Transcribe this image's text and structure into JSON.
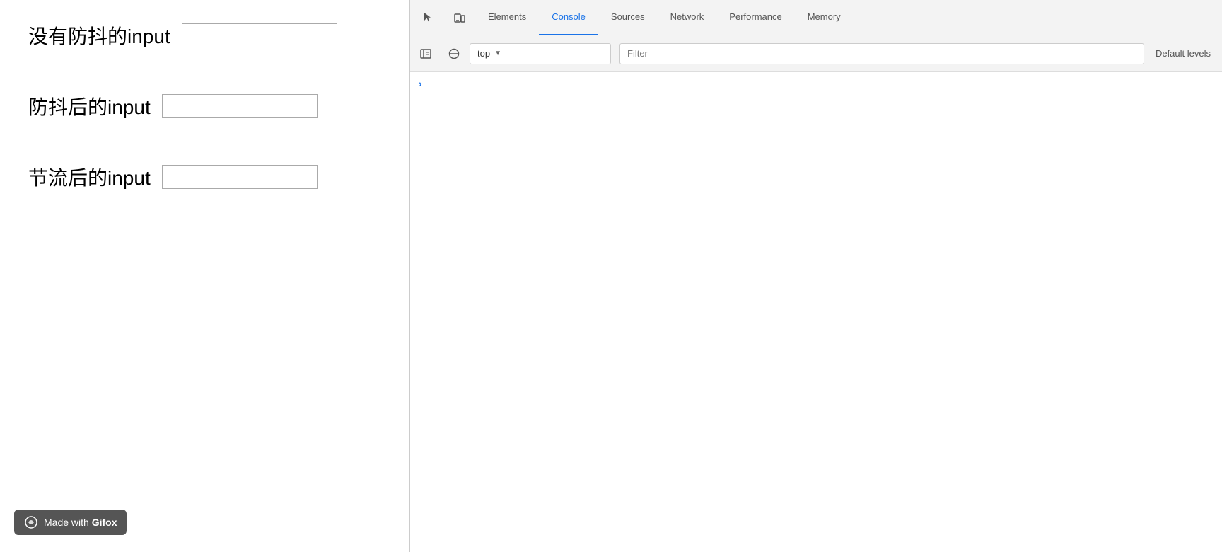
{
  "left": {
    "inputs": [
      {
        "label": "没有防抖的input",
        "placeholder": ""
      },
      {
        "label": "防抖后的input",
        "placeholder": ""
      },
      {
        "label": "节流后的input",
        "placeholder": ""
      }
    ],
    "badge": {
      "prefix": "Made with ",
      "brand": "Gifox"
    }
  },
  "devtools": {
    "tabs": [
      {
        "id": "elements",
        "label": "Elements",
        "active": false
      },
      {
        "id": "console",
        "label": "Console",
        "active": true
      },
      {
        "id": "sources",
        "label": "Sources",
        "active": false
      },
      {
        "id": "network",
        "label": "Network",
        "active": false
      },
      {
        "id": "performance",
        "label": "Performance",
        "active": false
      },
      {
        "id": "memory",
        "label": "Memory",
        "active": false
      }
    ],
    "console": {
      "context": "top",
      "filter_placeholder": "Filter",
      "default_label": "Default levels"
    }
  }
}
